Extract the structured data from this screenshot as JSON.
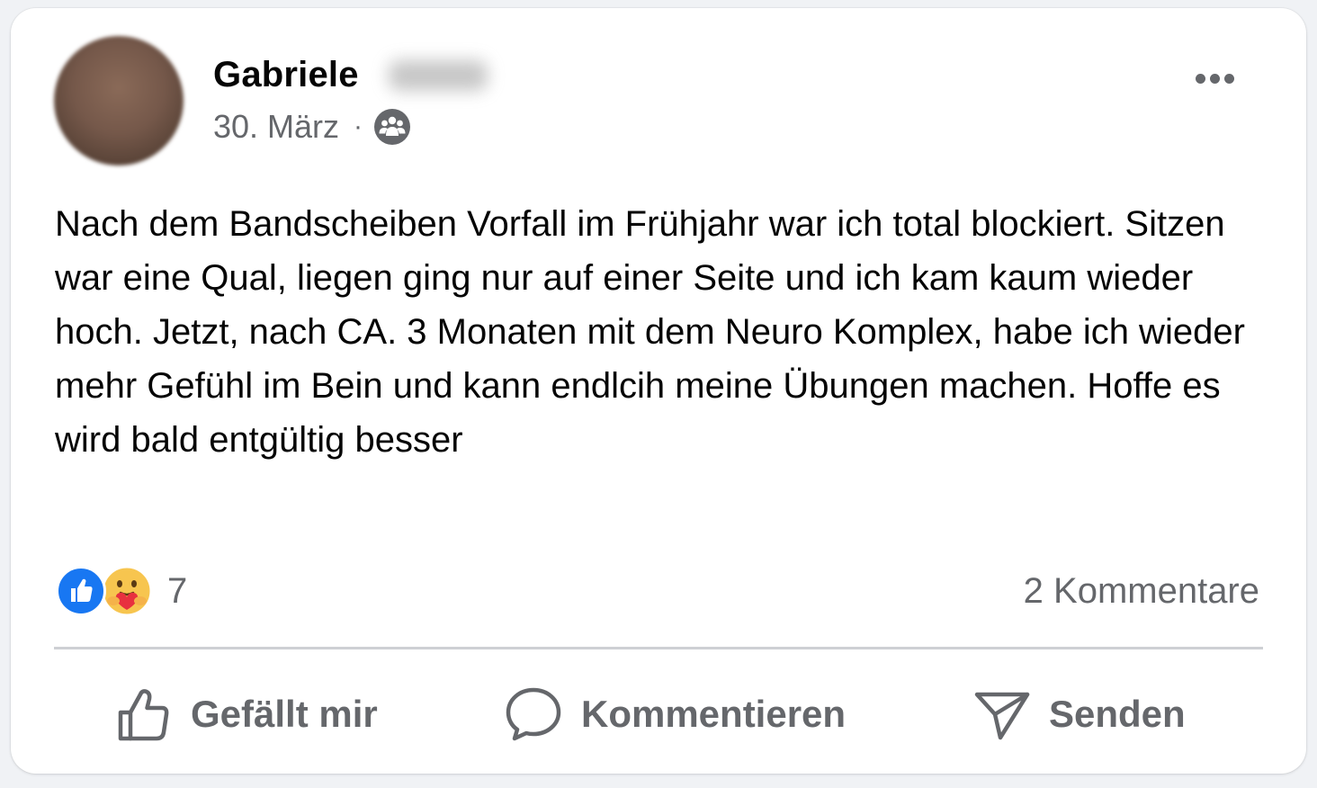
{
  "post": {
    "author_first_name": "Gabriele",
    "date": "30. März",
    "separator": "·",
    "audience_icon": "group-icon",
    "text": "Nach dem Bandscheiben Vorfall im Frühjahr war ich total blockiert. Sitzen war eine Qual, liegen ging nur auf einer Seite und ich kam kaum wieder hoch. Jetzt, nach CA. 3 Monaten mit dem Neuro Komplex, habe ich wieder mehr Gefühl im Bein und kann endlcih meine Übungen machen. Hoffe es wird bald entgültig besser"
  },
  "reactions": {
    "icons": [
      "like-icon",
      "care-icon"
    ],
    "count": "7"
  },
  "comments": {
    "label": "2 Kommentare"
  },
  "actions": {
    "like_label": "Gefällt mir",
    "comment_label": "Kommentieren",
    "send_label": "Senden"
  },
  "colors": {
    "like_blue": "#1877f2",
    "muted_text": "#65676b",
    "divider": "#ced0d4"
  }
}
